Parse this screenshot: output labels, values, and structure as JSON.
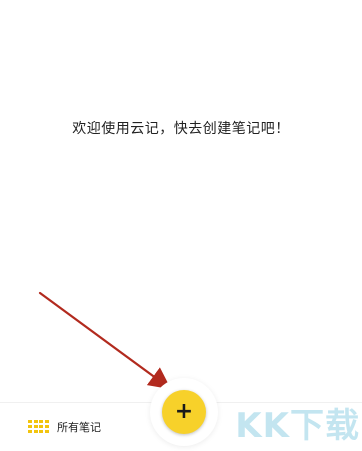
{
  "main": {
    "empty_message": "欢迎使用云记，快去创建笔记吧！"
  },
  "bottom_nav": {
    "all_notes_label": "所有笔记",
    "all_notes_icon": "grid-icon"
  },
  "fab": {
    "icon": "plus-icon",
    "symbol": "+"
  },
  "watermark": {
    "text": "KK下载"
  },
  "colors": {
    "accent_yellow": "#f7d12a",
    "annotation_arrow": "#b22a1e",
    "text": "#222222",
    "background": "#ffffff"
  }
}
